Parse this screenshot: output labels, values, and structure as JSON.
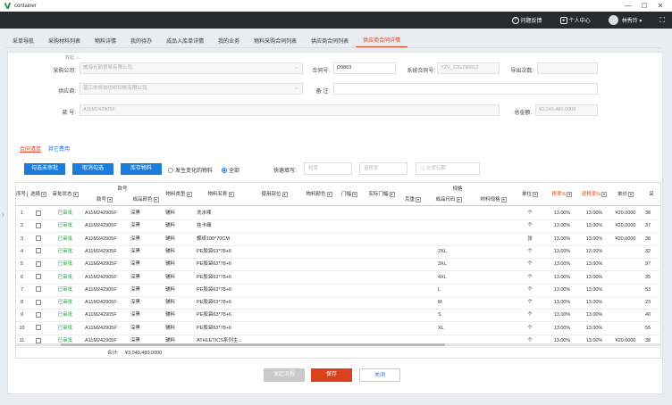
{
  "window": {
    "title": "container",
    "min": "—",
    "max": "☐",
    "close": "✕"
  },
  "topbar": {
    "feedback": "问题反馈",
    "user_center": "个人中心",
    "username": "林秀玲 ▾",
    "expand": "⛶"
  },
  "tabs": [
    "采单导航",
    "采购材料列表",
    "物料详情",
    "我的待办",
    "成品入库单详情",
    "我的业务",
    "物料采购合同列表",
    "供应商合同列表",
    "供应商合同详情"
  ],
  "active_tab": 8,
  "form": {
    "fold": "收起 ︿",
    "purchase_company_label": "采购公司:",
    "purchase_company": "威海光丽贸易有限公司",
    "contract_no_label": "合同号:",
    "contract_no": "D9863",
    "sys_contract_label": "系统合同号:",
    "sys_contract": "YZV_22G290012",
    "export_count_label": "导出次数:",
    "export_count": "",
    "supplier_label": "供应商:",
    "supplier": "晋江市领衣纺织印刷有限公司",
    "remark_label": "备 注:",
    "remark": "",
    "sku_label": "款 号:",
    "sku": "A11M242905F",
    "total_label": "总金额:",
    "total": "¥3,049,480.0000"
  },
  "linktabs": [
    "合同清单",
    "其它费用"
  ],
  "toolbar": {
    "select_unsigned": "勾选未审批",
    "cancel_select": "取消勾选",
    "stock_material": "库存物料",
    "radio_changed": "发生变化的物料",
    "radio_all": "全部",
    "quick_fill": "快速填写:",
    "tax_rate_ph": "税率",
    "refund_rate_ph": "退税率",
    "delivery_ph": "交货日期"
  },
  "grid": {
    "headers": {
      "seq": "序号",
      "check": "选择",
      "approve": "审批状态",
      "style_group": "款号",
      "style_no": "款号",
      "color": "成品颜色",
      "mat_type": "物料类型",
      "mat_name": "物料名称",
      "use_part": "使用部位",
      "mat_color": "物料颜色",
      "width": "门幅",
      "real_width": "实际门幅",
      "spec_group": "规格",
      "weight": "克重",
      "size": "成品尺码",
      "mat_spec": "材料规格",
      "unit": "单位",
      "tax": "税率%",
      "refund": "退税率%",
      "price": "单价",
      "more": "采"
    },
    "rows": [
      {
        "seq": "1",
        "status": "已审批",
        "style": "A11M242905F",
        "color": "深黑",
        "type": "辅料",
        "name": "洗水唛",
        "size": "",
        "unit": "个",
        "tax": "13.00%",
        "refund": "13.00%",
        "price": "¥20.0000",
        "qty": "38"
      },
      {
        "seq": "2",
        "status": "已审批",
        "style": "A11M242905F",
        "color": "深黑",
        "type": "辅料",
        "name": "挂卡绳",
        "size": "",
        "unit": "个",
        "tax": "13.00%",
        "refund": "13.00%",
        "price": "¥20.0000",
        "qty": "37"
      },
      {
        "seq": "3",
        "status": "已审批",
        "style": "A11M242905F",
        "color": "深黑",
        "type": "辅料",
        "name": "蝶纸100*70CM",
        "size": "",
        "unit": "张",
        "tax": "13.00%",
        "refund": "13.00%",
        "price": "¥20.0000",
        "qty": "38"
      },
      {
        "seq": "4",
        "status": "已审批",
        "style": "A11M242905F",
        "color": "深黑",
        "type": "辅料",
        "name": "PE胶袋63*78+6",
        "size": "2XL",
        "unit": "个",
        "tax": "13.00%",
        "refund": "13.00%",
        "price": "",
        "qty": "32"
      },
      {
        "seq": "5",
        "status": "已审批",
        "style": "A11M242905F",
        "color": "深黑",
        "type": "辅料",
        "name": "PE胶袋63*78+6",
        "size": "3XL",
        "unit": "个",
        "tax": "13.00%",
        "refund": "13.00%",
        "price": "",
        "qty": "97"
      },
      {
        "seq": "6",
        "status": "已审批",
        "style": "A11M242905F",
        "color": "深黑",
        "type": "辅料",
        "name": "PE胶袋63*78+6",
        "size": "4XL",
        "unit": "个",
        "tax": "13.00%",
        "refund": "13.00%",
        "price": "",
        "qty": "35"
      },
      {
        "seq": "7",
        "status": "已审批",
        "style": "A11M242905F",
        "color": "深黑",
        "type": "辅料",
        "name": "PE胶袋63*78+6",
        "size": "L",
        "unit": "个",
        "tax": "13.00%",
        "refund": "13.00%",
        "price": "",
        "qty": "53"
      },
      {
        "seq": "8",
        "status": "已审批",
        "style": "A11M242905F",
        "color": "深黑",
        "type": "辅料",
        "name": "PE胶袋63*78+6",
        "size": "M",
        "unit": "个",
        "tax": "13.00%",
        "refund": "13.00%",
        "price": "",
        "qty": "23"
      },
      {
        "seq": "9",
        "status": "已审批",
        "style": "A11M242905F",
        "color": "深黑",
        "type": "辅料",
        "name": "PE胶袋63*78+6",
        "size": "S",
        "unit": "个",
        "tax": "13.00%",
        "refund": "13.00%",
        "price": "",
        "qty": "40"
      },
      {
        "seq": "10",
        "status": "已审批",
        "style": "A11M242905F",
        "color": "深黑",
        "type": "辅料",
        "name": "PE胶袋63*78+6",
        "size": "XL",
        "unit": "个",
        "tax": "13.00%",
        "refund": "13.00%",
        "price": "",
        "qty": "55"
      },
      {
        "seq": "11",
        "status": "已审批",
        "style": "A11M242905F",
        "color": "深黑",
        "type": "辅料",
        "name": "ATHLETICS系列主...",
        "size": "",
        "unit": "个",
        "tax": "13.00%",
        "refund": "13.00%",
        "price": "¥20.0000",
        "qty": "38"
      }
    ],
    "sum_label": "合计:",
    "sum_value": "¥3,049,480.0000"
  },
  "footer": {
    "approve_flow": "发起流程",
    "save": "保存",
    "close": "关闭"
  },
  "colors": {
    "accent": "#1b7ddb",
    "danger": "#e0431d",
    "ok": "#2aa04a",
    "topbar": "#262a31"
  }
}
